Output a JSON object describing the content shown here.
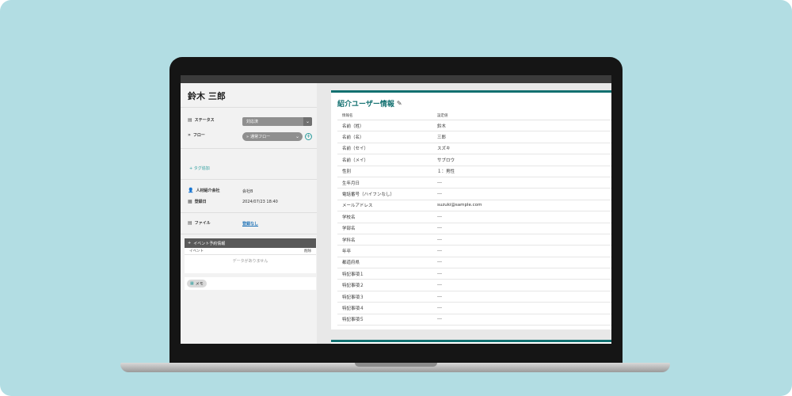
{
  "colors": {
    "background": "#b2dde3",
    "accent": "#127070",
    "link": "#1a6fb5"
  },
  "left_panel": {
    "name": "鈴木 三郎",
    "status_label": "ステータス",
    "status_value": "対応済",
    "flow_label": "フロー",
    "flow_value": "通常フロー",
    "tag_add": "+ タグ追加",
    "agency_label": "人材紹介会社",
    "agency_value": "会社B",
    "registered_label": "登録日",
    "registered_value": "2024/07/23 18:40",
    "file_label": "ファイル",
    "file_value": "登録なし",
    "event_panel": {
      "title": "イベント予約情報",
      "col_event": "イベント",
      "col_delete": "削除",
      "empty": "データがありません"
    },
    "memo_label": "メモ"
  },
  "right_panel": {
    "title": "紹介ユーザー情報",
    "col_item": "情報名",
    "col_value": "設定値",
    "rows": [
      {
        "label": "名前（姓）",
        "value": "鈴木"
      },
      {
        "label": "名前（名）",
        "value": "三郎"
      },
      {
        "label": "名前（セイ）",
        "value": "スズキ"
      },
      {
        "label": "名前（メイ）",
        "value": "サブロウ"
      },
      {
        "label": "性別",
        "value": "１：男性"
      },
      {
        "label": "生年月日",
        "value": "---"
      },
      {
        "label": "電話番号（ハイフンなし）",
        "value": "---"
      },
      {
        "label": "メールアドレス",
        "value": "suzuki@sample.com"
      },
      {
        "label": "学校名",
        "value": "---"
      },
      {
        "label": "学部名",
        "value": "---"
      },
      {
        "label": "学科名",
        "value": "---"
      },
      {
        "label": "年卒",
        "value": "---"
      },
      {
        "label": "都道府県",
        "value": "---"
      },
      {
        "label": "特記事項１",
        "value": "---"
      },
      {
        "label": "特記事項２",
        "value": "---"
      },
      {
        "label": "特記事項３",
        "value": "---"
      },
      {
        "label": "特記事項４",
        "value": "---"
      },
      {
        "label": "特記事項５",
        "value": "---"
      }
    ]
  }
}
